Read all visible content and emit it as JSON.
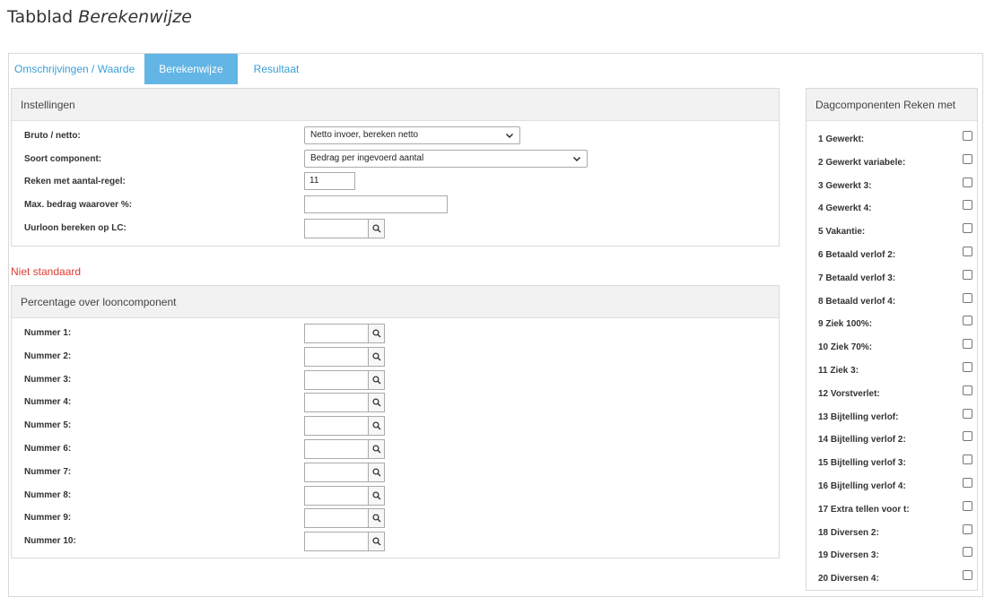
{
  "page": {
    "heading_plain": "Tabblad ",
    "heading_italic": "Berekenwijze"
  },
  "tabs": [
    {
      "label": "Omschrijvingen / Waarde",
      "active": false
    },
    {
      "label": "Berekenwijze",
      "active": true
    },
    {
      "label": "Resultaat",
      "active": false
    }
  ],
  "settings": {
    "title": "Instellingen",
    "bruto_netto": {
      "label": "Bruto / netto:",
      "value": "Netto invoer, bereken netto"
    },
    "soort_component": {
      "label": "Soort component:",
      "value": "Bedrag per ingevoerd aantal"
    },
    "reken_aantal": {
      "label": "Reken met aantal-regel:",
      "value": "11"
    },
    "max_bedrag": {
      "label": "Max. bedrag waarover %:",
      "value": ""
    },
    "uurloon": {
      "label": "Uurloon bereken op LC:",
      "value": ""
    }
  },
  "non_standard_note": "Niet standaard",
  "percentage": {
    "title": "Percentage over looncomponent",
    "rows": [
      {
        "label": "Nummer 1:",
        "value": ""
      },
      {
        "label": "Nummer 2:",
        "value": ""
      },
      {
        "label": "Nummer 3:",
        "value": ""
      },
      {
        "label": "Nummer 4:",
        "value": ""
      },
      {
        "label": "Nummer 5:",
        "value": ""
      },
      {
        "label": "Nummer 6:",
        "value": ""
      },
      {
        "label": "Nummer 7:",
        "value": ""
      },
      {
        "label": "Nummer 8:",
        "value": ""
      },
      {
        "label": "Nummer 9:",
        "value": ""
      },
      {
        "label": "Nummer 10:",
        "value": ""
      }
    ]
  },
  "day_components": {
    "title": "Dagcomponenten Reken met",
    "items": [
      {
        "label": "1 Gewerkt:",
        "checked": false
      },
      {
        "label": "2 Gewerkt variabele:",
        "checked": false
      },
      {
        "label": "3 Gewerkt 3:",
        "checked": false
      },
      {
        "label": "4 Gewerkt 4:",
        "checked": false
      },
      {
        "label": "5 Vakantie:",
        "checked": false
      },
      {
        "label": "6 Betaald verlof 2:",
        "checked": false
      },
      {
        "label": "7 Betaald verlof 3:",
        "checked": false
      },
      {
        "label": "8 Betaald verlof 4:",
        "checked": false
      },
      {
        "label": "9 Ziek 100%:",
        "checked": false
      },
      {
        "label": "10 Ziek 70%:",
        "checked": false
      },
      {
        "label": "11 Ziek 3:",
        "checked": false
      },
      {
        "label": "12 Vorstverlet:",
        "checked": false
      },
      {
        "label": "13 Bijtelling verlof:",
        "checked": false
      },
      {
        "label": "14 Bijtelling verlof 2:",
        "checked": false
      },
      {
        "label": "15 Bijtelling verlof 3:",
        "checked": false
      },
      {
        "label": "16 Bijtelling verlof 4:",
        "checked": false
      },
      {
        "label": "17 Extra tellen voor t:",
        "checked": false
      },
      {
        "label": "18 Diversen 2:",
        "checked": false
      },
      {
        "label": "19 Diversen 3:",
        "checked": false
      },
      {
        "label": "20 Diversen 4:",
        "checked": false
      }
    ]
  },
  "icons": {
    "lookup": "search-icon",
    "dropdown": "chevron-down-icon"
  },
  "colors": {
    "accent": "#63b5e5",
    "link": "#3a9fd6",
    "warning": "#e03b2f"
  }
}
